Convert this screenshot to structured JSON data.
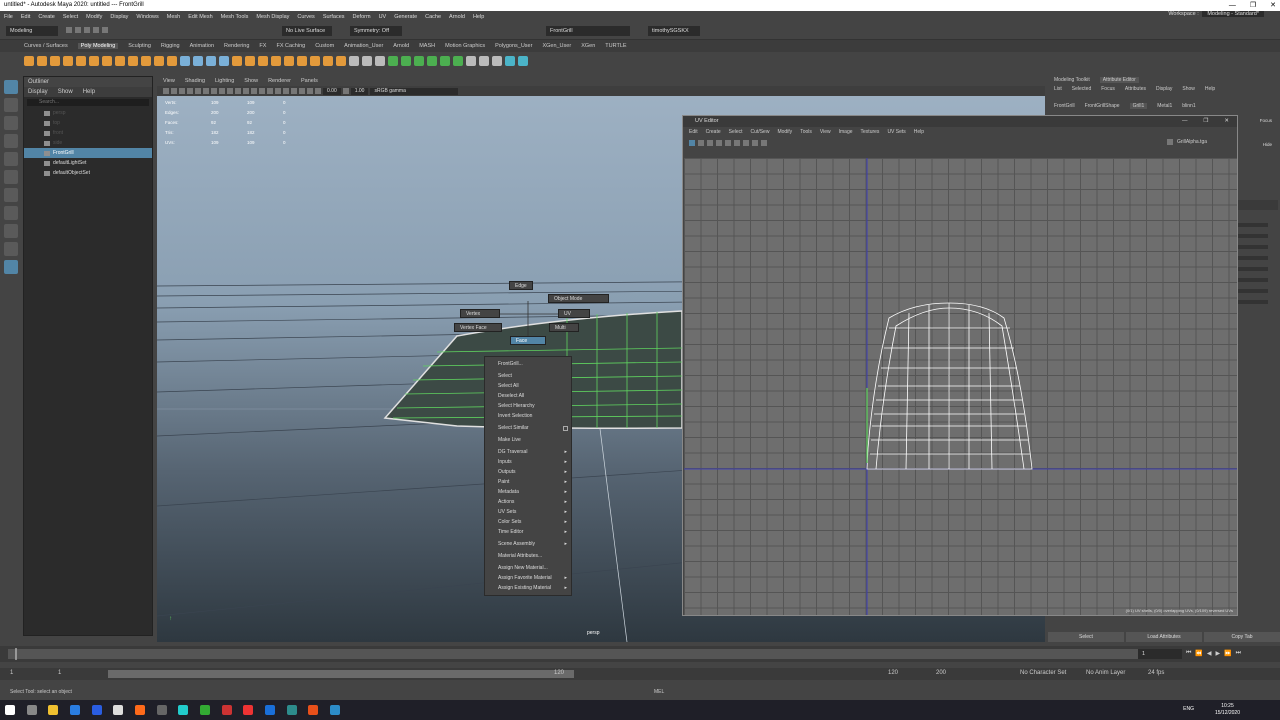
{
  "window": {
    "title": "untitled* - Autodesk Maya 2020: untitled   ---   FrontGrill"
  },
  "menubar": [
    "File",
    "Edit",
    "Create",
    "Select",
    "Modify",
    "Display",
    "Windows",
    "Mesh",
    "Edit Mesh",
    "Mesh Tools",
    "Mesh Display",
    "Curves",
    "Surfaces",
    "Deform",
    "UV",
    "Generate",
    "Cache",
    "Arnold",
    "Help"
  ],
  "workspace": {
    "label": "Workspace :",
    "value": "Modeling - Standard*"
  },
  "statusline": {
    "mode": "Modeling",
    "live": "No Live Surface",
    "symmetry": "Symmetry: Off",
    "object": "FrontGrill",
    "user": "timothySGSKX"
  },
  "shelftabs": [
    "Curves / Surfaces",
    "Poly Modeling",
    "Sculpting",
    "Rigging",
    "Animation",
    "Rendering",
    "FX",
    "FX Caching",
    "Custom",
    "Animation_User",
    "Arnold",
    "MASH",
    "Motion Graphics",
    "Polygons_User",
    "XGen_User",
    "XGen",
    "TURTLE"
  ],
  "outliner": {
    "title": "Outliner",
    "menu": [
      "Display",
      "Show",
      "Help"
    ],
    "search": "Search...",
    "items": [
      {
        "label": "persp",
        "selected": false,
        "dim": true
      },
      {
        "label": "top",
        "selected": false,
        "dim": true
      },
      {
        "label": "front",
        "selected": false,
        "dim": true
      },
      {
        "label": "side",
        "selected": false,
        "dim": true
      },
      {
        "label": "FrontGrill",
        "selected": true,
        "dim": false
      },
      {
        "label": "defaultLightSet",
        "selected": false,
        "dim": false
      },
      {
        "label": "defaultObjectSet",
        "selected": false,
        "dim": false
      }
    ]
  },
  "viewport": {
    "menu": [
      "View",
      "Shading",
      "Lighting",
      "Show",
      "Renderer",
      "Panels"
    ],
    "field1": "0.00",
    "field2": "1.00",
    "colorspace": "sRGB gamma",
    "camera": "persp",
    "hud": [
      {
        "k": "Verts:",
        "a": "109",
        "b": "109",
        "c": "0"
      },
      {
        "k": "Edges:",
        "a": "200",
        "b": "200",
        "c": "0"
      },
      {
        "k": "Faces:",
        "a": "92",
        "b": "92",
        "c": "0"
      },
      {
        "k": "Tris:",
        "a": "182",
        "b": "182",
        "c": "0"
      },
      {
        "k": "UVs:",
        "a": "109",
        "b": "109",
        "c": "0"
      }
    ]
  },
  "marking_menu": {
    "edge": "Edge",
    "object_mode": "Object Mode",
    "vertex": "Vertex",
    "uv": "UV",
    "vertex_face": "Vertex Face",
    "multi": "Multi",
    "face": "Face"
  },
  "context_menu": {
    "header": "FrontGrill...",
    "groups": [
      [
        {
          "label": "Select"
        },
        {
          "label": "Select All"
        },
        {
          "label": "Deselect All"
        },
        {
          "label": "Select Hierarchy"
        },
        {
          "label": "Invert Selection"
        }
      ],
      [
        {
          "label": "Select Similar",
          "box": true
        }
      ],
      [
        {
          "label": "Make Live"
        }
      ],
      [
        {
          "label": "DG Traversal",
          "sub": true
        },
        {
          "label": "Inputs",
          "sub": true
        },
        {
          "label": "Outputs",
          "sub": true
        },
        {
          "label": "Paint",
          "sub": true
        },
        {
          "label": "Metadata",
          "sub": true
        },
        {
          "label": "Actions",
          "sub": true
        },
        {
          "label": "UV Sets",
          "sub": true
        },
        {
          "label": "Color Sets",
          "sub": true
        },
        {
          "label": "Time Editor",
          "sub": true
        }
      ],
      [
        {
          "label": "Scene Assembly",
          "sub": true
        }
      ],
      [
        {
          "label": "Material Attributes..."
        }
      ],
      [
        {
          "label": "Assign New Material..."
        },
        {
          "label": "Assign Favorite Material",
          "sub": true
        },
        {
          "label": "Assign Existing Material",
          "sub": true
        }
      ]
    ]
  },
  "uv_editor": {
    "title": "UV Editor",
    "menu": [
      "Edit",
      "Create",
      "Select",
      "Cut/Sew",
      "Modify",
      "Tools",
      "View",
      "Image",
      "Textures",
      "UV Sets",
      "Help"
    ],
    "texture": "GrillAlpha.tga",
    "status": "(0/1) UV shells, (0/0) overlapping UVs, (0/109) reversed UVs"
  },
  "attribute_editor": {
    "top_tabs": [
      "Modeling Toolkit",
      "Attribute Editor"
    ],
    "menu": [
      "List",
      "Selected",
      "Focus",
      "Attributes",
      "Display",
      "Show",
      "Help"
    ],
    "node_tabs": [
      "FrontGrill",
      "FrontGrillShape",
      "Grill1",
      "Metal1",
      "blinn1"
    ],
    "focus_label": "Focus",
    "hide_label": "Hide",
    "buttons": [
      "Select",
      "Load Attributes",
      "Copy Tab"
    ]
  },
  "timeline": {
    "start": "1",
    "current": "1",
    "range_end": "120",
    "end1": "120",
    "end2": "200",
    "frame_field": "1",
    "character_set": "No Character Set",
    "anim_layer": "No Anim Layer",
    "fps": "24 fps"
  },
  "helpline": {
    "text": "Select Tool: select an object",
    "mel": "MEL"
  },
  "taskbar": {
    "time": "10:25",
    "date": "15/12/2020",
    "lang": "ENG"
  },
  "colors": {
    "highlight": "#5285a6",
    "uv_grid": "#6e6e6e",
    "mesh_green": "#5fd35f"
  }
}
